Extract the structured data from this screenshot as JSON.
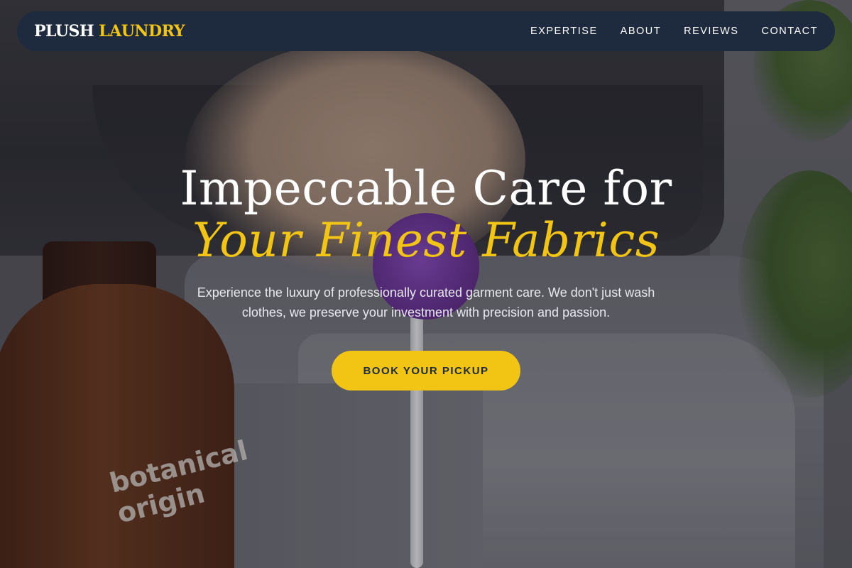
{
  "brand": {
    "name_part_1": "PLUSH",
    "name_part_2": "LAUNDRY",
    "primary_color": "#1e2a3e",
    "accent_color": "#f2c413"
  },
  "nav": {
    "items": [
      {
        "label": "EXPERTISE"
      },
      {
        "label": "ABOUT"
      },
      {
        "label": "REVIEWS"
      },
      {
        "label": "CONTACT"
      }
    ]
  },
  "hero": {
    "headline_line_1": "Impeccable Care for",
    "headline_line_2": "Your Finest Fabrics",
    "subtitle": "Experience the luxury of professionally curated garment care. We don't just wash clothes, we preserve your investment with precision and passion.",
    "cta_label": "BOOK YOUR PICKUP",
    "background_label_text": "botanical origin"
  }
}
